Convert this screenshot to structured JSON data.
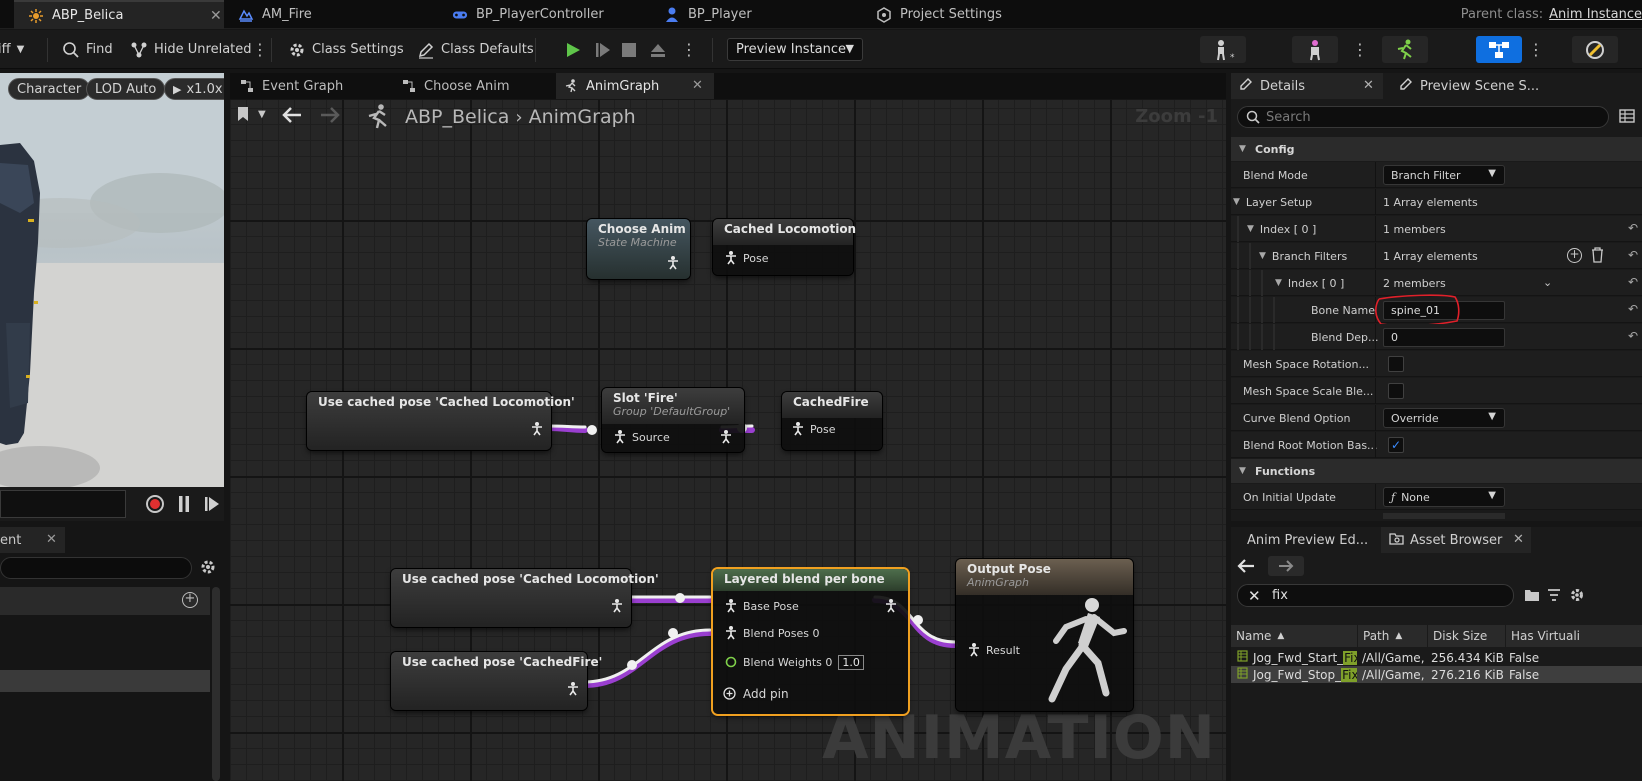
{
  "tabs": [
    {
      "label": "ABP_Belica",
      "active": true
    },
    {
      "label": "AM_Fire"
    },
    {
      "label": "BP_PlayerController"
    },
    {
      "label": "BP_Player"
    },
    {
      "label": "Project Settings"
    }
  ],
  "parent_class": {
    "label": "Parent class:",
    "value": "Anim Instance"
  },
  "toolbar": {
    "diff": "Diff",
    "find": "Find",
    "hide_unrelated": "Hide Unrelated",
    "class_settings": "Class Settings",
    "class_defaults": "Class Defaults",
    "preview_instance": "Preview Instance"
  },
  "viewport": {
    "character": "Character",
    "lod": "LOD Auto",
    "speed": "x1.0x"
  },
  "left_panel": {
    "tab": "ent"
  },
  "graph_tabs": [
    {
      "label": "Event Graph"
    },
    {
      "label": "Choose Anim"
    },
    {
      "label": "AnimGraph",
      "active": true
    }
  ],
  "breadcrumb": {
    "root": "ABP_Belica",
    "current": "AnimGraph"
  },
  "zoom": "Zoom -1",
  "watermark": "ANIMATION",
  "nodes": {
    "choose_anim": {
      "title": "Choose Anim",
      "subtitle": "State Machine"
    },
    "cached_locomotion": {
      "title": "Cached Locomotion",
      "pin": "Pose"
    },
    "use_cached_loco_1": {
      "title": "Use cached pose 'Cached Locomotion'"
    },
    "slot_fire": {
      "title": "Slot 'Fire'",
      "subtitle": "Group 'DefaultGroup'",
      "pin": "Source"
    },
    "cached_fire": {
      "title": "CachedFire",
      "pin": "Pose"
    },
    "use_cached_loco_2": {
      "title": "Use cached pose 'Cached Locomotion'"
    },
    "use_cached_fire": {
      "title": "Use cached pose 'CachedFire'"
    },
    "layered_blend": {
      "title": "Layered blend per bone",
      "base_pose": "Base Pose",
      "blend_poses": "Blend Poses 0",
      "blend_weights": "Blend Weights 0",
      "weight_value": "1.0",
      "add_pin": "Add pin"
    },
    "output_pose": {
      "title": "Output Pose",
      "subtitle": "AnimGraph",
      "pin": "Result"
    }
  },
  "details": {
    "tab": "Details",
    "tab2": "Preview Scene S...",
    "search_placeholder": "Search",
    "config": "Config",
    "blend_mode_label": "Blend Mode",
    "blend_mode_value": "Branch Filter",
    "layer_setup_label": "Layer Setup",
    "layer_setup_value": "1 Array elements",
    "index0_label": "Index [ 0 ]",
    "index0_value": "1 members",
    "branch_filters_label": "Branch Filters",
    "branch_filters_value": "1 Array elements",
    "index0b_label": "Index [ 0 ]",
    "index0b_value": "2 members",
    "bone_name_label": "Bone Name",
    "bone_name_value": "spine_01",
    "blend_depth_label": "Blend Dep...",
    "blend_depth_value": "0",
    "mesh_rot_label": "Mesh Space Rotation...",
    "mesh_scale_label": "Mesh Space Scale Ble...",
    "curve_blend_label": "Curve Blend Option",
    "curve_blend_value": "Override",
    "root_motion_label": "Blend Root Motion Bas...",
    "functions": "Functions",
    "initial_update_label": "On Initial Update",
    "initial_update_value": "None"
  },
  "asset_browser": {
    "tab1": "Anim Preview Ed...",
    "tab2": "Asset Browser",
    "search_value": "fix",
    "columns": [
      "Name",
      "Path",
      "Disk Size",
      "Has Virtuali"
    ],
    "rows": [
      {
        "name": "Jog_Fwd_Start_",
        "match": "Fix",
        "path": "/All/Game,",
        "size": "256.434 KiB",
        "virtual": "False"
      },
      {
        "name": "Jog_Fwd_Stop_",
        "match": "Fix",
        "path": "/All/Game,",
        "size": "276.216 KiB",
        "virtual": "False"
      }
    ]
  },
  "colors": {
    "accent": "#0f6fe0",
    "selection": "#f0a020",
    "pose_wire": "#9a3fd0",
    "annotation": "#e0202a"
  }
}
